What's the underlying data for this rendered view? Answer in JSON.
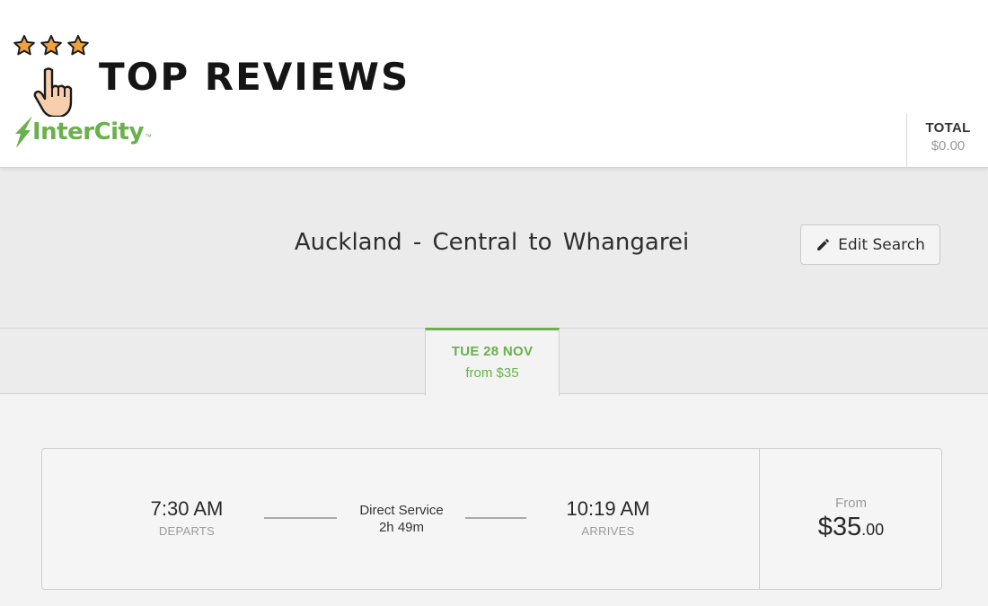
{
  "badge": {
    "title": "TOP REVIEWS",
    "icons": [
      "star-icon",
      "star-icon",
      "star-icon",
      "hand-pointer-icon"
    ]
  },
  "brand": {
    "name": "InterCity",
    "trademark": "™",
    "color": "#6ab04c"
  },
  "cart": {
    "total_label": "TOTAL",
    "total_value": "$0.00"
  },
  "search": {
    "route": "Auckland - Central to Whangarei",
    "edit_label": "Edit Search",
    "edit_icon": "pencil-icon"
  },
  "date_tabs": [
    {
      "date": "TUE 28 NOV",
      "price": "from $35",
      "selected": true
    }
  ],
  "trip": {
    "depart_time": "7:30 AM",
    "depart_caption": "DEPARTS",
    "service_type": "Direct Service",
    "duration": "2h 49m",
    "arrive_time": "10:19 AM",
    "arrive_caption": "ARRIVES",
    "price_prefix": "From",
    "price_dollars": "$35",
    "price_cents": ".00"
  },
  "colors": {
    "accent": "#6ab04c",
    "star": "#f0a13a",
    "header_bg": "#ffffff",
    "band_bg": "#ebebeb"
  }
}
